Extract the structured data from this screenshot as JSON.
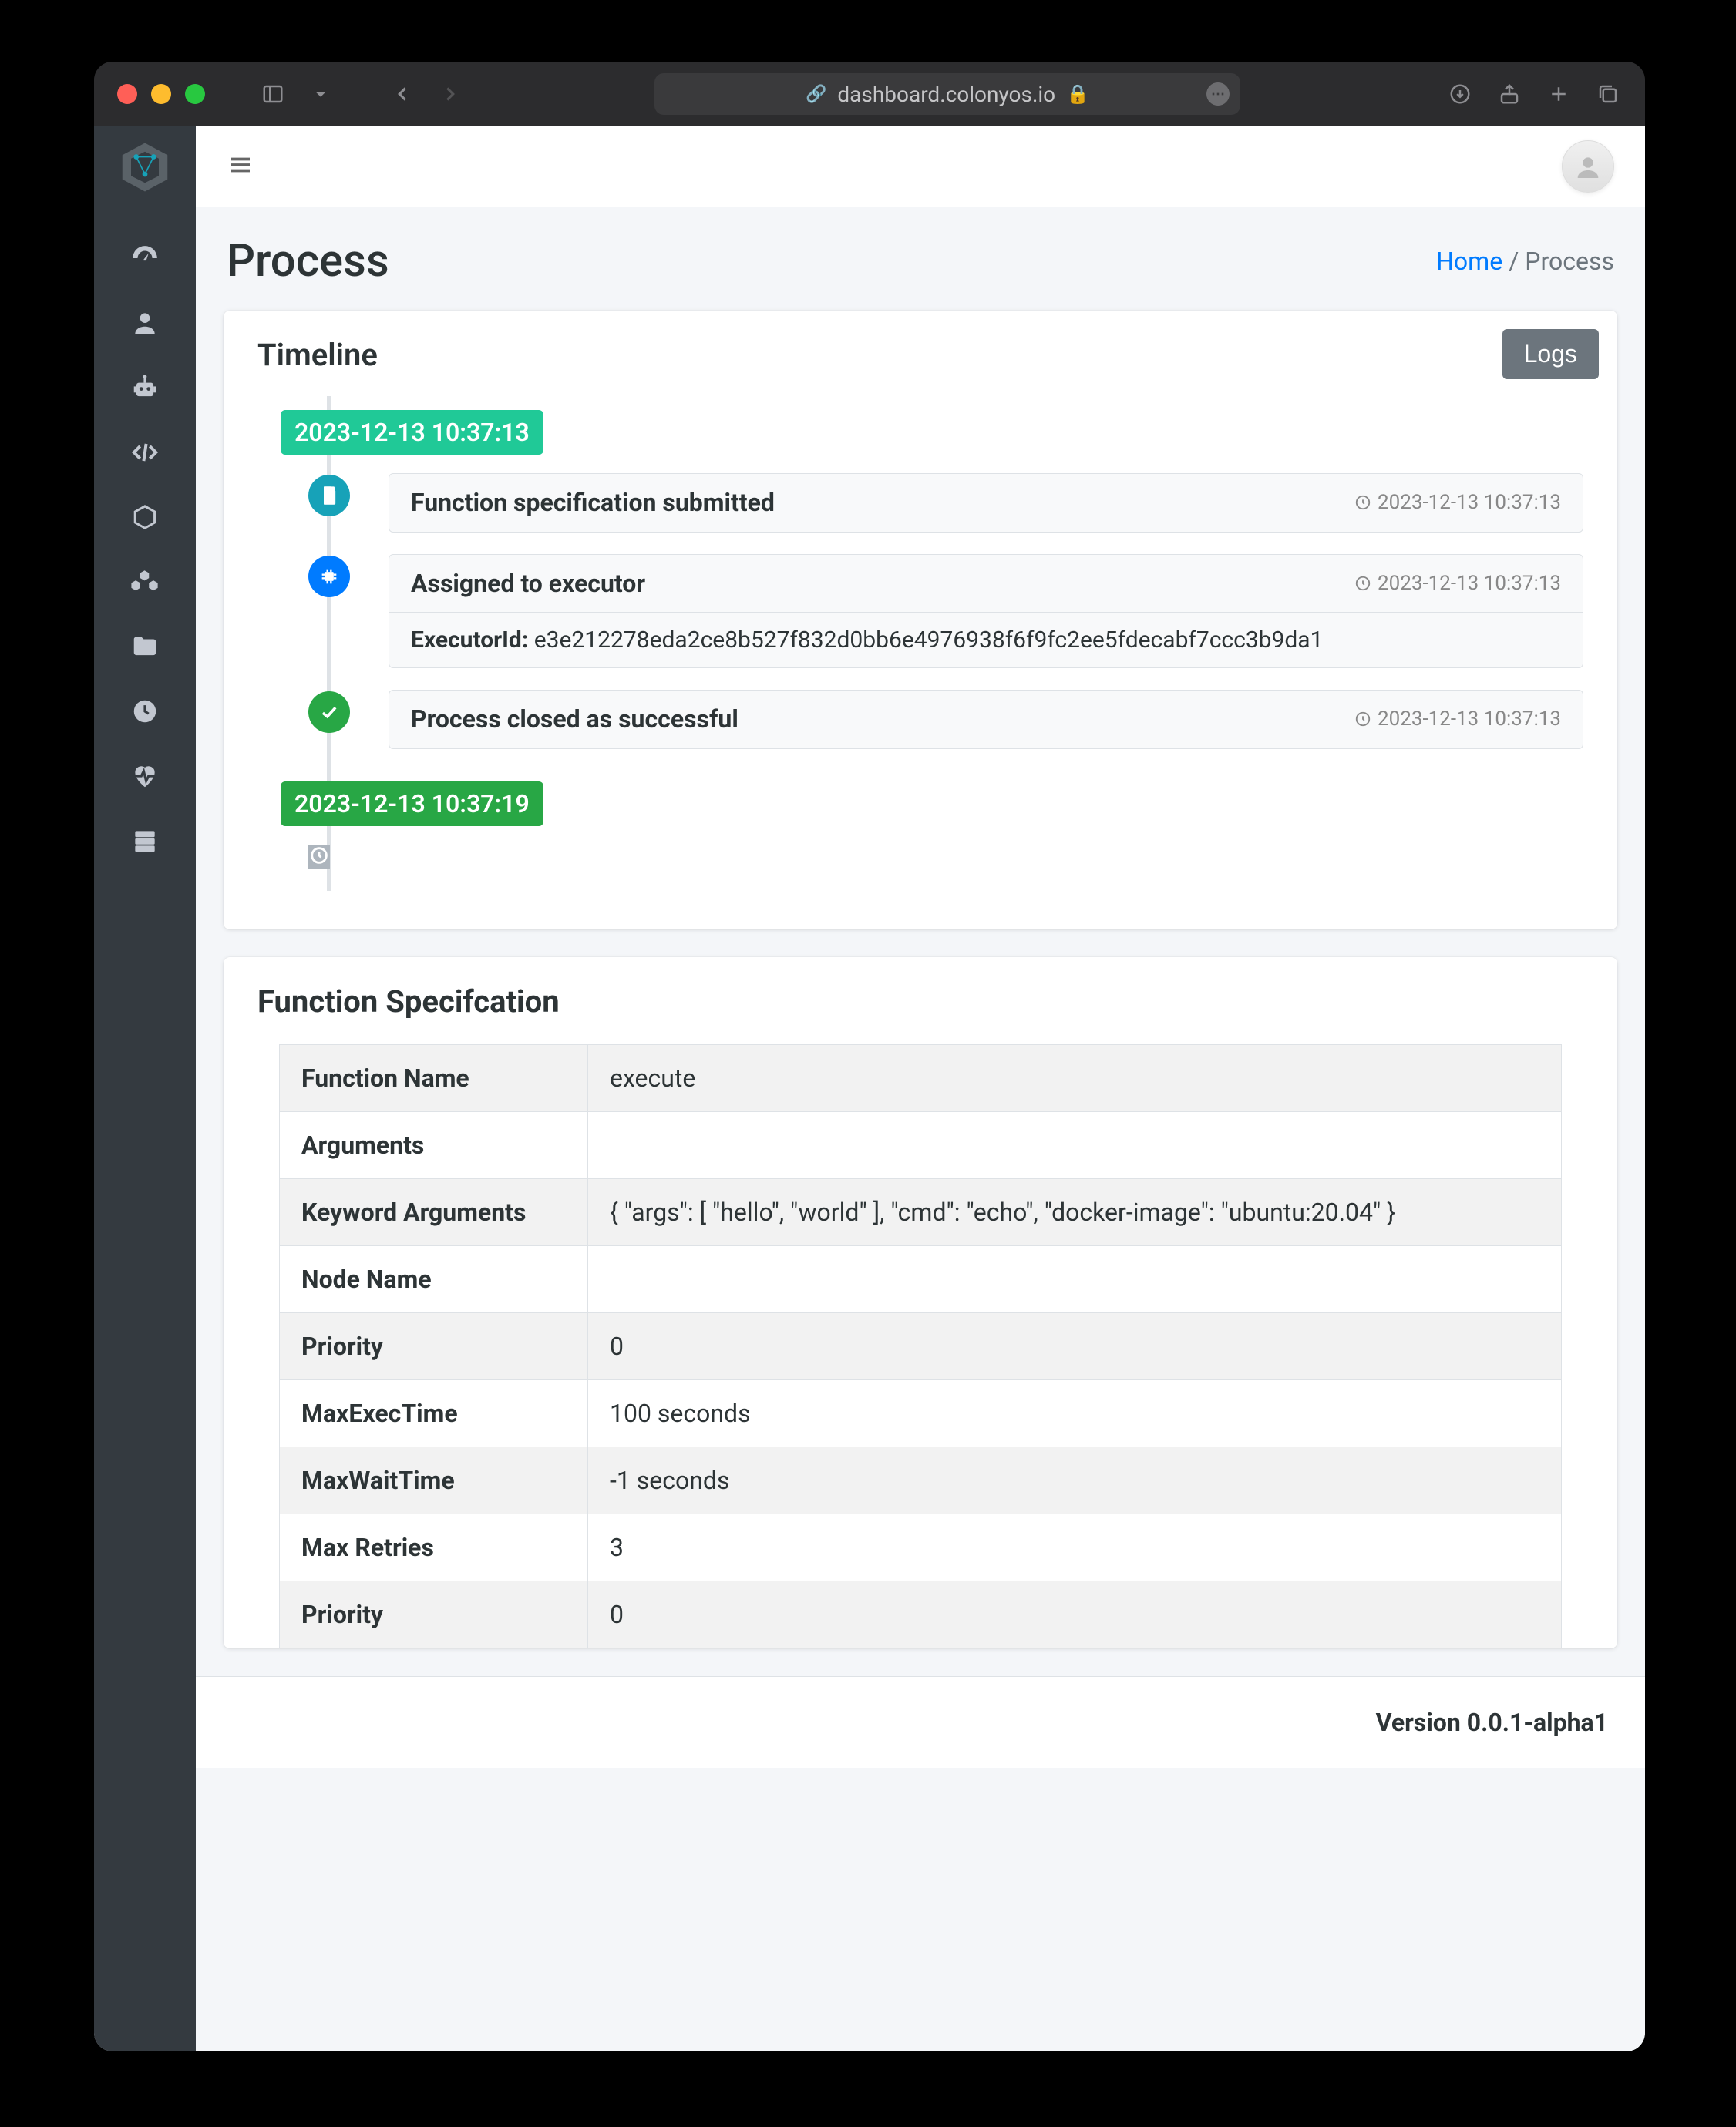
{
  "browser": {
    "url_host": "dashboard.colonyos.io"
  },
  "sidebar": {
    "items": [
      {
        "name": "dashboard-icon"
      },
      {
        "name": "user-icon"
      },
      {
        "name": "robot-icon"
      },
      {
        "name": "code-icon"
      },
      {
        "name": "cube-icon"
      },
      {
        "name": "cubes-icon"
      },
      {
        "name": "folder-icon"
      },
      {
        "name": "clock-icon"
      },
      {
        "name": "heartbeat-icon"
      },
      {
        "name": "server-icon"
      }
    ]
  },
  "header": {
    "title": "Process",
    "breadcrumb_home": "Home",
    "breadcrumb_sep": "/",
    "breadcrumb_current": "Process"
  },
  "timeline": {
    "title": "Timeline",
    "logs_button": "Logs",
    "start_label": "2023-12-13 10:37:13",
    "end_label": "2023-12-13 10:37:19",
    "events": [
      {
        "title": "Function specification submitted",
        "time": "2023-12-13 10:37:13"
      },
      {
        "title": "Assigned to executor",
        "time": "2023-12-13 10:37:13",
        "detail_label": "ExecutorId:",
        "detail_value": "e3e212278eda2ce8b527f832d0bb6e4976938f6f9fc2ee5fdecabf7ccc3b9da1"
      },
      {
        "title": "Process closed as successful",
        "time": "2023-12-13 10:37:13"
      }
    ]
  },
  "spec": {
    "title": "Function Specifcation",
    "rows": [
      {
        "k": "Function Name",
        "v": "execute"
      },
      {
        "k": "Arguments",
        "v": ""
      },
      {
        "k": "Keyword Arguments",
        "v": "{ \"args\": [ \"hello\", \"world\" ], \"cmd\": \"echo\", \"docker-image\": \"ubuntu:20.04\" }"
      },
      {
        "k": "Node Name",
        "v": ""
      },
      {
        "k": "Priority",
        "v": "0"
      },
      {
        "k": "MaxExecTime",
        "v": "100 seconds"
      },
      {
        "k": "MaxWaitTime",
        "v": "-1 seconds"
      },
      {
        "k": "Max Retries",
        "v": "3"
      },
      {
        "k": "Priority",
        "v": "0"
      }
    ]
  },
  "footer": {
    "version": "Version 0.0.1-alpha1"
  }
}
